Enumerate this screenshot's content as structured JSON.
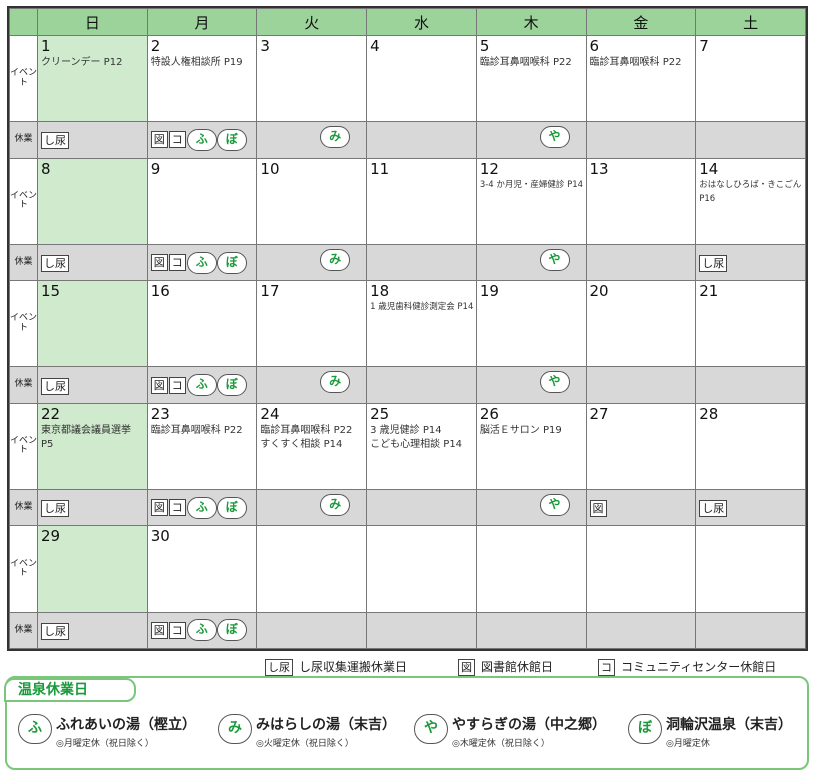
{
  "weekdays": [
    "日",
    "月",
    "火",
    "水",
    "木",
    "金",
    "土"
  ],
  "row_labels": {
    "event": "イベント",
    "closed": "休業"
  },
  "weeks": [
    {
      "dates": [
        "1",
        "2",
        "3",
        "4",
        "5",
        "6",
        "7"
      ],
      "events": [
        [
          "クリーンデー P12"
        ],
        [
          "特設人権相談所 P19"
        ],
        [],
        [],
        [
          "臨診耳鼻咽喉科 P22"
        ],
        [
          "臨診耳鼻咽喉科 P22"
        ],
        []
      ]
    },
    {
      "dates": [
        "8",
        "9",
        "10",
        "11",
        "12",
        "13",
        "14"
      ],
      "events": [
        [],
        [],
        [],
        [],
        [
          "3-4 か月児・産婦健診 P14"
        ],
        [],
        [
          "おはなしひろば・きこごん",
          "P16"
        ]
      ]
    },
    {
      "dates": [
        "15",
        "16",
        "17",
        "18",
        "19",
        "20",
        "21"
      ],
      "events": [
        [],
        [],
        [],
        [
          "1 歳児歯科健診測定会 P14"
        ],
        [],
        [],
        []
      ]
    },
    {
      "dates": [
        "22",
        "23",
        "24",
        "25",
        "26",
        "27",
        "28"
      ],
      "events": [
        [
          "東京都議会議員選挙",
          "P5"
        ],
        [
          "臨診耳鼻咽喉科 P22"
        ],
        [
          "臨診耳鼻咽喉科 P22",
          "すくすく相談 P14"
        ],
        [
          "3 歳児健診 P14",
          "こども心理相談 P14"
        ],
        [
          "脳活Ｅサロン P19"
        ],
        [],
        []
      ]
    },
    {
      "dates": [
        "29",
        "30",
        "",
        "",
        "",
        "",
        ""
      ],
      "events": [
        [],
        [],
        [],
        [],
        [],
        [],
        []
      ]
    }
  ],
  "closures": {
    "shinyo": "し尿",
    "tosho": "図",
    "komyu": "コ",
    "fu": "ふ",
    "bo": "ぼ",
    "mi": "み",
    "ya": "や"
  },
  "legend": {
    "shinyo_label": "し尿収集運搬休業日",
    "tosho_label": "図書館休館日",
    "komyu_label": "コミュニティセンター休館日"
  },
  "onsen": {
    "title": "温泉休業日",
    "springs": [
      {
        "mark": "ふ",
        "name": "ふれあいの湯（樫立）",
        "note": "◎月曜定休（祝日除く）"
      },
      {
        "mark": "み",
        "name": "みはらしの湯（末吉）",
        "note": "◎火曜定休（祝日除く）"
      },
      {
        "mark": "や",
        "name": "やすらぎの湯（中之郷）",
        "note": "◎木曜定休（祝日除く）"
      },
      {
        "mark": "ぼ",
        "name": "洞輪沢温泉（末吉）",
        "note": "◎月曜定休"
      }
    ]
  },
  "colors": {
    "sunday": "#cfeacd",
    "header": "#9bd39b",
    "closed_row": "#d8d8d8",
    "onsen_green": "#1a9a3a"
  }
}
